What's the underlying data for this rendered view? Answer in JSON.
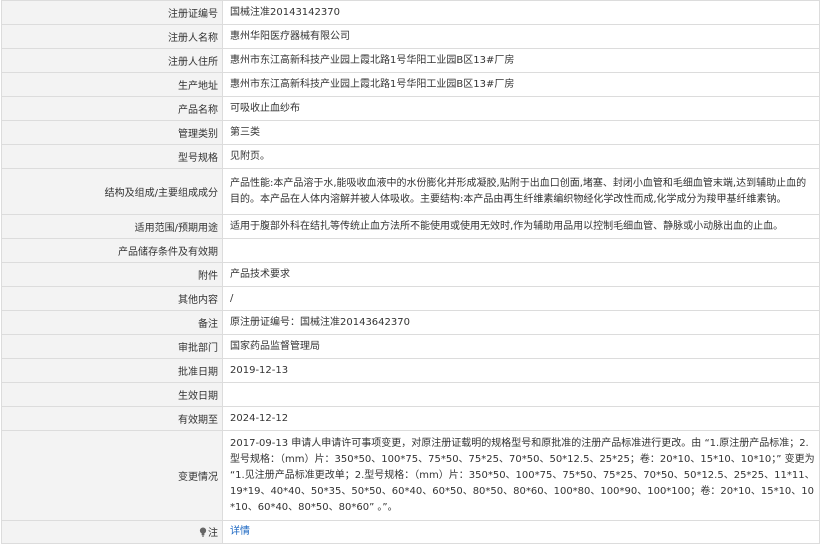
{
  "rows": [
    {
      "label": "注册证编号",
      "value": "国械注准20143142370"
    },
    {
      "label": "注册人名称",
      "value": "惠州华阳医疗器械有限公司"
    },
    {
      "label": "注册人住所",
      "value": "惠州市东江高新科技产业园上霞北路1号华阳工业园B区13#厂房"
    },
    {
      "label": "生产地址",
      "value": "惠州市东江高新科技产业园上霞北路1号华阳工业园B区13#厂房"
    },
    {
      "label": "产品名称",
      "value": "可吸收止血纱布"
    },
    {
      "label": "管理类别",
      "value": "第三类"
    },
    {
      "label": "型号规格",
      "value": "见附页。"
    },
    {
      "label": "结构及组成/主要组成成分",
      "value": "产品性能:本产品溶于水,能吸收血液中的水份膨化并形成凝胶,贴附于出血口创面,堵塞、封闭小血管和毛细血管末端,达到辅助止血的目的。本产品在人体内溶解并被人体吸收。主要结构:本产品由再生纤维素编织物经化学改性而成,化学成分为羧甲基纤维素钠。"
    },
    {
      "label": "适用范围/预期用途",
      "value": "适用于腹部外科在结扎等传统止血方法所不能使用或使用无效时,作为辅助用品用以控制毛细血管、静脉或小动脉出血的止血。"
    },
    {
      "label": "产品储存条件及有效期",
      "value": ""
    },
    {
      "label": "附件",
      "value": "产品技术要求"
    },
    {
      "label": "其他内容",
      "value": "/"
    },
    {
      "label": "备注",
      "value": "原注册证编号：国械注准20143642370"
    },
    {
      "label": "审批部门",
      "value": "国家药品监督管理局"
    },
    {
      "label": "批准日期",
      "value": "2019-12-13"
    },
    {
      "label": "生效日期",
      "value": ""
    },
    {
      "label": "有效期至",
      "value": "2024-12-12"
    },
    {
      "label": "变更情况",
      "value": "2017-09-13 申请人申请许可事项变更，对原注册证载明的规格型号和原批准的注册产品标准进行更改。由 “1.原注册产品标准；2.型号规格：（mm）片：350*50、100*75、75*50、75*25、70*50、50*12.5、25*25；卷：20*10、15*10、10*10；” 变更为 “1.见注册产品标准更改单；2.型号规格：（mm）片：350*50、100*75、75*50、75*25、70*50、50*12.5、25*25、11*11、19*19、40*40、50*35、50*50、60*40、60*50、80*50、80*60、100*80、100*90、100*100；卷：20*10、15*10、10*10、60*40、80*50、80*60” 。”。"
    }
  ],
  "note": {
    "label": "注",
    "link": "详情",
    "icon": "lightbulb-icon"
  }
}
